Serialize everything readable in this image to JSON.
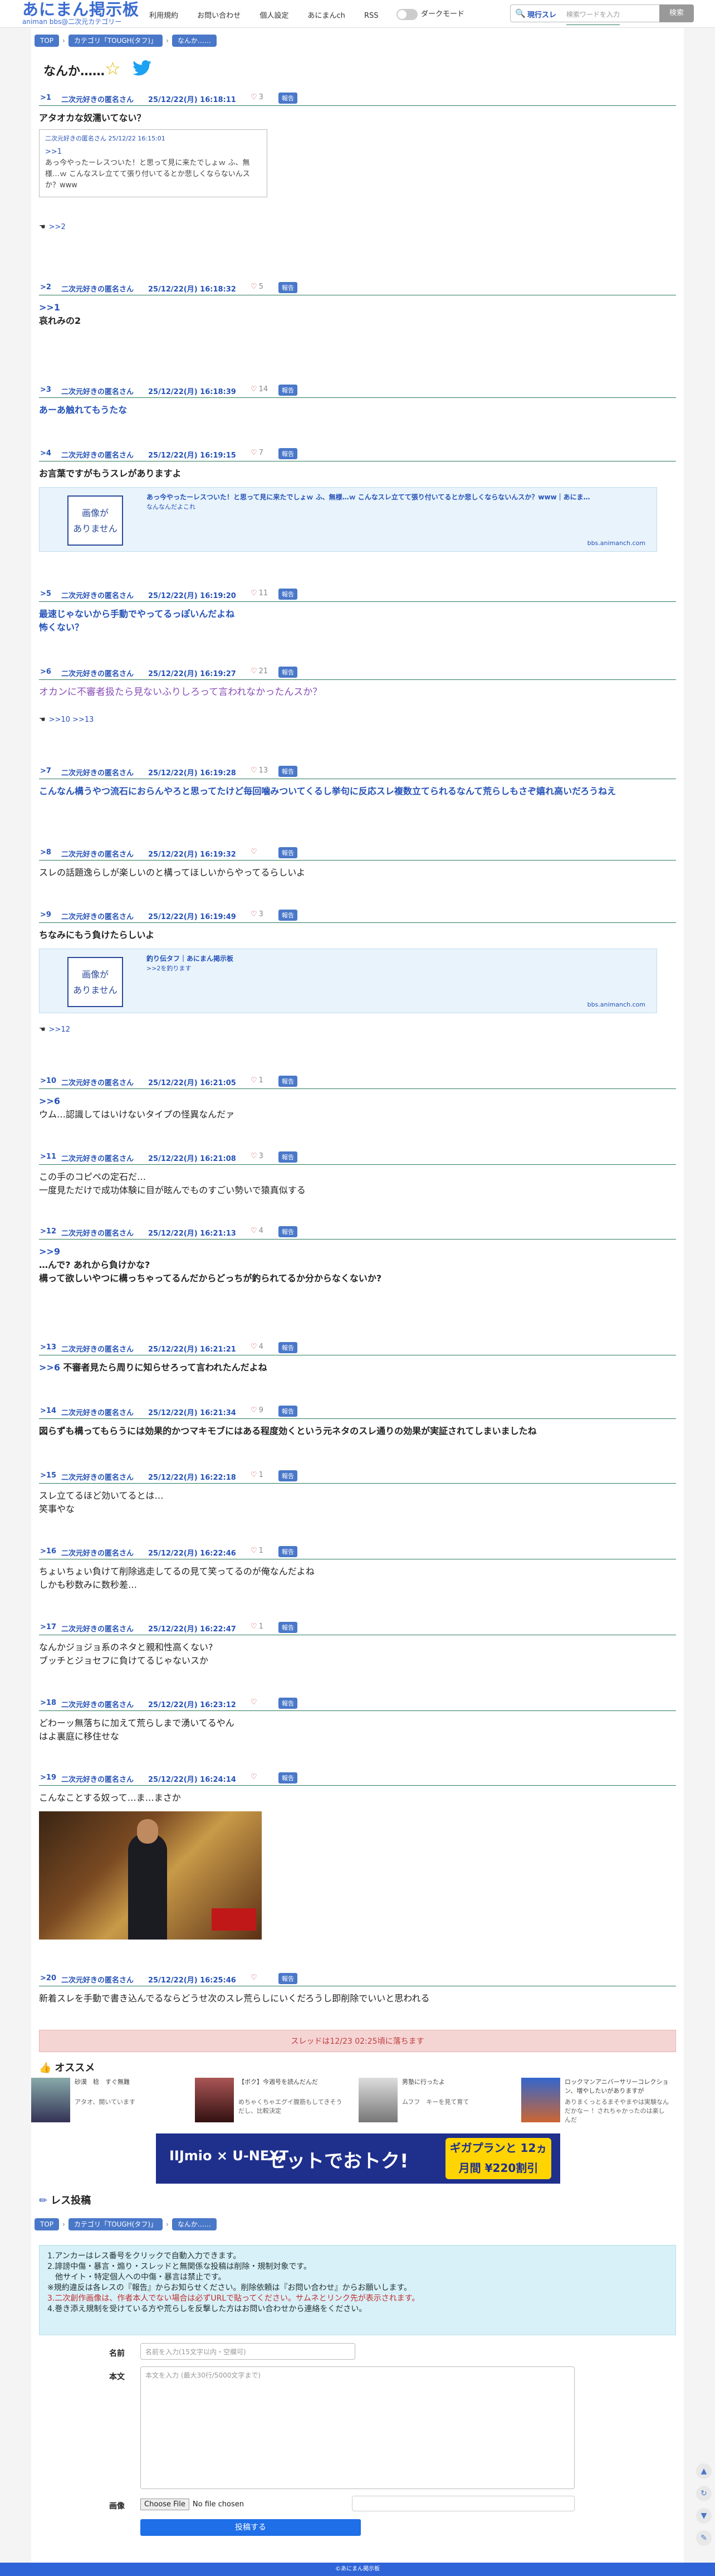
{
  "site": {
    "logo_main": "あにまん掲示板",
    "logo_sub": "animan bbs@二次元カテゴリー"
  },
  "nav": [
    "利用規約",
    "お問い合わせ",
    "個人設定",
    "あにまんch",
    "RSS"
  ],
  "dark_mode_label": "ダークモード",
  "search": {
    "scope": "現行スレ",
    "placeholder": "検索ワードを入力",
    "button": "検索"
  },
  "breadcrumb": [
    "TOP",
    "カテゴリ「TOUGH(タフ)」",
    "なんか……"
  ],
  "thread_title": "なんか……",
  "posts": [
    {
      "no": ">1",
      "name": "二次元好きの匿名さん",
      "date": "25/12/22(月) 16:18:11",
      "likes": "3",
      "report": "報告",
      "body": "アタオカな奴濡いてない？"
    },
    {
      "no": ">2",
      "name": "二次元好きの匿名さん",
      "date": "25/12/22(月) 16:18:32",
      "likes": "5",
      "report": "報告",
      "anchor": ">>1",
      "body": "哀れみの2"
    },
    {
      "no": ">3",
      "name": "二次元好きの匿名さん",
      "date": "25/12/22(月) 16:18:39",
      "likes": "14",
      "report": "報告",
      "body": "あーあ触れてもうたな"
    },
    {
      "no": ">4",
      "name": "二次元好きの匿名さん",
      "date": "25/12/22(月) 16:19:15",
      "likes": "7",
      "report": "報告",
      "body": "お言葉ですがもうスレがありますよ"
    },
    {
      "no": ">5",
      "name": "二次元好きの匿名さん",
      "date": "25/12/22(月) 16:19:20",
      "likes": "11",
      "report": "報告",
      "body": "最速じゃないから手動でやってるっぽいんだよね",
      "body2": "怖くない？"
    },
    {
      "no": ">6",
      "name": "二次元好きの匿名さん",
      "date": "25/12/22(月) 16:19:27",
      "likes": "21",
      "report": "報告",
      "body": "オカンに不審者扱たら見ないふりしろって言われなかったんスか？"
    },
    {
      "no": ">7",
      "name": "二次元好きの匿名さん",
      "date": "25/12/22(月) 16:19:28",
      "likes": "13",
      "report": "報告",
      "body": "こんなん構うやつ流石におらんやろと思ってたけど毎回噛みついてくるし挙句に反応スレ複数立てられるなんて荒らしもさぞ嬉れ高いだろうねえ"
    },
    {
      "no": ">8",
      "name": "二次元好きの匿名さん",
      "date": "25/12/22(月) 16:19:32",
      "likes": "",
      "report": "報告",
      "body": "スレの話題逸らしが楽しいのと構ってほしいからやってるらしいよ"
    },
    {
      "no": ">9",
      "name": "二次元好きの匿名さん",
      "date": "25/12/22(月) 16:19:49",
      "likes": "3",
      "report": "報告",
      "body": "ちなみにもう負けたらしいよ"
    },
    {
      "no": ">10",
      "name": "二次元好きの匿名さん",
      "date": "25/12/22(月) 16:21:05",
      "likes": "1",
      "report": "報告",
      "anchor": ">>6",
      "body": "ウム…認識してはいけないタイプの怪異なんだァ"
    },
    {
      "no": ">11",
      "name": "二次元好きの匿名さん",
      "date": "25/12/22(月) 16:21:08",
      "likes": "3",
      "report": "報告",
      "body": "この手のコピペの定石だ…",
      "body2": "一度見ただけで成功体験に目が眩んでものすごい勢いで猿真似する"
    },
    {
      "no": ">12",
      "name": "二次元好きの匿名さん",
      "date": "25/12/22(月) 16:21:13",
      "likes": "4",
      "report": "報告",
      "anchor": ">>9",
      "body": "…んで? あれから負けかな?",
      "body2": "構って欲しいやつに構っちゃってるんだからどっちが釣られてるか分からなくないか?"
    },
    {
      "no": ">13",
      "name": "二次元好きの匿名さん",
      "date": "25/12/22(月) 16:21:21",
      "likes": "4",
      "report": "報告",
      "anchor": ">>6",
      "body": "不審者見たら周りに知らせろって言われたんだよね"
    },
    {
      "no": ">14",
      "name": "二次元好きの匿名さん",
      "date": "25/12/22(月) 16:21:34",
      "likes": "9",
      "report": "報告",
      "body": "図らずも構ってもらうには効果的かつマキモブにはある程度効くという元ネタのスレ通りの効果が実証されてしまいましたね"
    },
    {
      "no": ">15",
      "name": "二次元好きの匿名さん",
      "date": "25/12/22(月) 16:22:18",
      "likes": "1",
      "report": "報告",
      "body": "スレ立てるほど効いてるとは…",
      "body2": "笑事やな"
    },
    {
      "no": ">16",
      "name": "二次元好きの匿名さん",
      "date": "25/12/22(月) 16:22:46",
      "likes": "1",
      "report": "報告",
      "body": "ちょいちょい負けて削除逃走してるの見て笑ってるのが俺なんだよね",
      "body2": "しかも秒数みに数秒差…"
    },
    {
      "no": ">17",
      "name": "二次元好きの匿名さん",
      "date": "25/12/22(月) 16:22:47",
      "likes": "1",
      "report": "報告",
      "body": "なんかジョジョ系のネタと親和性高くない?",
      "body2": "ブッチとジョセフに負けてるじゃないスか"
    },
    {
      "no": ">18",
      "name": "二次元好きの匿名さん",
      "date": "25/12/22(月) 16:23:12",
      "likes": "",
      "report": "報告",
      "body": "どわーッ無落ちに加えて荒らしまで湧いてるやん",
      "body2": "はよ裏庭に移住せな"
    },
    {
      "no": ">19",
      "name": "二次元好きの匿名さん",
      "date": "25/12/22(月) 16:24:14",
      "likes": "",
      "report": "報告",
      "body": "こんなことする奴って…ま…まさか"
    },
    {
      "no": ">20",
      "name": "二次元好きの匿名さん",
      "date": "25/12/22(月) 16:25:46",
      "likes": "",
      "report": "報告",
      "body": "新着スレを手動で書き込んでるならどうせ次のスレ荒らしにいくだろうし即削除でいいと思われる"
    }
  ],
  "quote1": {
    "head": "二次元好きの匿名さん 25/12/22 16:15:01",
    "anchor": ">>1",
    "text": "あっ今やったーレスついた！と思って見に来たでしょｗ ふ、無様…ｗ こんなスレ立てて張り付いてるとか悲しくならないんスか？www"
  },
  "res_links": {
    "p1": ">>2",
    "p6": ">>10 >>13",
    "p9": ">>12"
  },
  "card4": {
    "title": "あっ今やったーレスついた！と思って見に来たでしょｗ ふ、無様…ｗ こんなスレ立てて張り付いてるとか悲しくならないんスか？www｜あにま…",
    "desc": "なんなんだよこれ",
    "url": "bbs.animanch.com",
    "noimg": "画像が\nありません"
  },
  "card9": {
    "title": "釣り伝タフ｜あにまん掲示板",
    "desc": ">>2を釣ります",
    "url": "bbs.animanch.com",
    "noimg": "画像が\nありません"
  },
  "notice": "スレッドは12/23 02:25頃に落ちます",
  "recommend_title": "オススメ",
  "recommend": [
    {
      "t1": "砂漠　稔　すぐ無難",
      "t2": "アタオ、開いています"
    },
    {
      "t1": "【ボク】今週号を読んだんだ",
      "t2": "めちゃくちゃエグイ腹筋もしてきそうだし、比較決定"
    },
    {
      "t1": "男塾に行ったよ",
      "t2": "ムフフ　キーを見て育て"
    },
    {
      "t1": "ロックマンアニバーサリーコレクション、増やしたいがありますが",
      "t2": "ありまくっとるまそやまやは実験なんだかなー ！されちゃかったのは楽しんだ"
    }
  ],
  "banner": {
    "brand": "IIJmio × U-NEXT",
    "main": "セットでおトク!",
    "promo": "ギガプランと 12ヵ月間 ¥220割引"
  },
  "response_title": "レス投稿",
  "rules": [
    "1.アンカーはレス番号をクリックで自動入力できます。",
    "2.誹謗中傷・暴言・煽り・スレッドと無関係な投稿は削除・規制対象です。",
    "　他サイト・特定個人への中傷・暴言は禁止です。",
    "※規約違反は各レスの『報告』からお知らせください。削除依頼は『お問い合わせ』からお願いします。",
    "3.二次創作画像は、作者本人でない場合は必ずURLで貼ってください。サムネとリンク先が表示されます。",
    "4.巻き添え規制を受けている方や荒らしを反撃した方はお問い合わせから連絡をください。"
  ],
  "form": {
    "name_label": "名前",
    "name_placeholder": "名前を入力(15文字以内・空欄可)",
    "body_label": "本文",
    "body_placeholder": "本文を入力 (最大30行/5000文字まで)",
    "image_label": "画像",
    "file_button": "Choose File",
    "file_status": "No file chosen",
    "submit": "投稿する"
  },
  "footer": "©あにまん掲示板"
}
